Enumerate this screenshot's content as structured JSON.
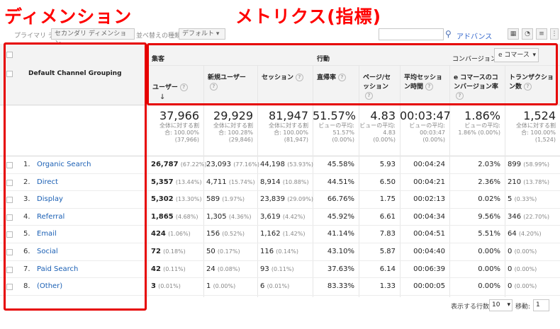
{
  "annotations": {
    "dimension_title": "ディメンション",
    "metrics_title": "メトリクス(指標)"
  },
  "toolbar": {
    "primary_dimension_label": "プライマリ ディメンション",
    "secondary_dimension_button": "セカンダリ ディメンション",
    "sort_type_label": "並べ替えの種類:",
    "sort_type_value": "デフォルト",
    "advanced_link": "アドバンス"
  },
  "table": {
    "dimension_header": "Default Channel Grouping",
    "groups": {
      "acquisition": "集客",
      "behavior": "行動",
      "conversion": "コンバージョン",
      "conversion_select": "e コマース"
    },
    "columns": [
      {
        "label": "ユーザー"
      },
      {
        "label": "新規ユーザー"
      },
      {
        "label": "セッション"
      },
      {
        "label": "直帰率"
      },
      {
        "label": "ページ/セッション"
      },
      {
        "label": "平均セッション時間"
      },
      {
        "label": "e コマースのコンバージョン率"
      },
      {
        "label": "トランザクション数"
      }
    ],
    "totals": [
      {
        "value": "37,966",
        "sub1": "全体に対する割",
        "sub2": "合: 100.00%",
        "sub3": "(37,966)"
      },
      {
        "value": "29,929",
        "sub1": "全体に対する割",
        "sub2": "合: 100.28%",
        "sub3": "(29,846)"
      },
      {
        "value": "81,947",
        "sub1": "全体に対する割",
        "sub2": "合: 100.00%",
        "sub3": "(81,947)"
      },
      {
        "value": "51.57%",
        "sub1": "ビューの平均:",
        "sub2": "51.57%",
        "sub3": "(0.00%)"
      },
      {
        "value": "4.83",
        "sub1": "ビューの平均:",
        "sub2": "4.83",
        "sub3": "(0.00%)"
      },
      {
        "value": "00:03:47",
        "sub1": "ビューの平均:",
        "sub2": "00:03:47",
        "sub3": "(0.00%)"
      },
      {
        "value": "1.86%",
        "sub1": "ビューの平均:",
        "sub2": "1.86% (0.00%)",
        "sub3": ""
      },
      {
        "value": "1,524",
        "sub1": "全体に対する割",
        "sub2": "合: 100.00%",
        "sub3": "(1,524)"
      }
    ],
    "rows": [
      {
        "num": "1.",
        "channel": "Organic Search",
        "users": "26,787",
        "users_pct": "(67.22%)",
        "new_users": "23,093",
        "new_users_pct": "(77.16%)",
        "sessions": "44,198",
        "sessions_pct": "(53.93%)",
        "bounce": "45.58%",
        "pps": "5.93",
        "avg_time": "00:04:24",
        "conv": "2.03%",
        "trans": "899",
        "trans_pct": "(58.99%)"
      },
      {
        "num": "2.",
        "channel": "Direct",
        "users": "5,357",
        "users_pct": "(13.44%)",
        "new_users": "4,711",
        "new_users_pct": "(15.74%)",
        "sessions": "8,914",
        "sessions_pct": "(10.88%)",
        "bounce": "44.51%",
        "pps": "6.50",
        "avg_time": "00:04:21",
        "conv": "2.36%",
        "trans": "210",
        "trans_pct": "(13.78%)"
      },
      {
        "num": "3.",
        "channel": "Display",
        "users": "5,302",
        "users_pct": "(13.30%)",
        "new_users": "589",
        "new_users_pct": "(1.97%)",
        "sessions": "23,839",
        "sessions_pct": "(29.09%)",
        "bounce": "66.76%",
        "pps": "1.75",
        "avg_time": "00:02:13",
        "conv": "0.02%",
        "trans": "5",
        "trans_pct": "(0.33%)"
      },
      {
        "num": "4.",
        "channel": "Referral",
        "users": "1,865",
        "users_pct": "(4.68%)",
        "new_users": "1,305",
        "new_users_pct": "(4.36%)",
        "sessions": "3,619",
        "sessions_pct": "(4.42%)",
        "bounce": "45.92%",
        "pps": "6.61",
        "avg_time": "00:04:34",
        "conv": "9.56%",
        "trans": "346",
        "trans_pct": "(22.70%)"
      },
      {
        "num": "5.",
        "channel": "Email",
        "users": "424",
        "users_pct": "(1.06%)",
        "new_users": "156",
        "new_users_pct": "(0.52%)",
        "sessions": "1,162",
        "sessions_pct": "(1.42%)",
        "bounce": "41.14%",
        "pps": "7.83",
        "avg_time": "00:04:51",
        "conv": "5.51%",
        "trans": "64",
        "trans_pct": "(4.20%)"
      },
      {
        "num": "6.",
        "channel": "Social",
        "users": "72",
        "users_pct": "(0.18%)",
        "new_users": "50",
        "new_users_pct": "(0.17%)",
        "sessions": "116",
        "sessions_pct": "(0.14%)",
        "bounce": "43.10%",
        "pps": "5.87",
        "avg_time": "00:04:40",
        "conv": "0.00%",
        "trans": "0",
        "trans_pct": "(0.00%)"
      },
      {
        "num": "7.",
        "channel": "Paid Search",
        "users": "42",
        "users_pct": "(0.11%)",
        "new_users": "24",
        "new_users_pct": "(0.08%)",
        "sessions": "93",
        "sessions_pct": "(0.11%)",
        "bounce": "37.63%",
        "pps": "6.14",
        "avg_time": "00:06:39",
        "conv": "0.00%",
        "trans": "0",
        "trans_pct": "(0.00%)"
      },
      {
        "num": "8.",
        "channel": "(Other)",
        "users": "3",
        "users_pct": "(0.01%)",
        "new_users": "1",
        "new_users_pct": "(0.00%)",
        "sessions": "6",
        "sessions_pct": "(0.01%)",
        "bounce": "83.33%",
        "pps": "1.33",
        "avg_time": "00:00:05",
        "conv": "0.00%",
        "trans": "0",
        "trans_pct": "(0.00%)"
      }
    ]
  },
  "footer": {
    "rows_label": "表示する行数:",
    "rows_value": "10",
    "goto_label": "移動:",
    "goto_value": "1"
  },
  "colors": {
    "annotation": "#ff0000",
    "link": "#1a5fb4"
  }
}
